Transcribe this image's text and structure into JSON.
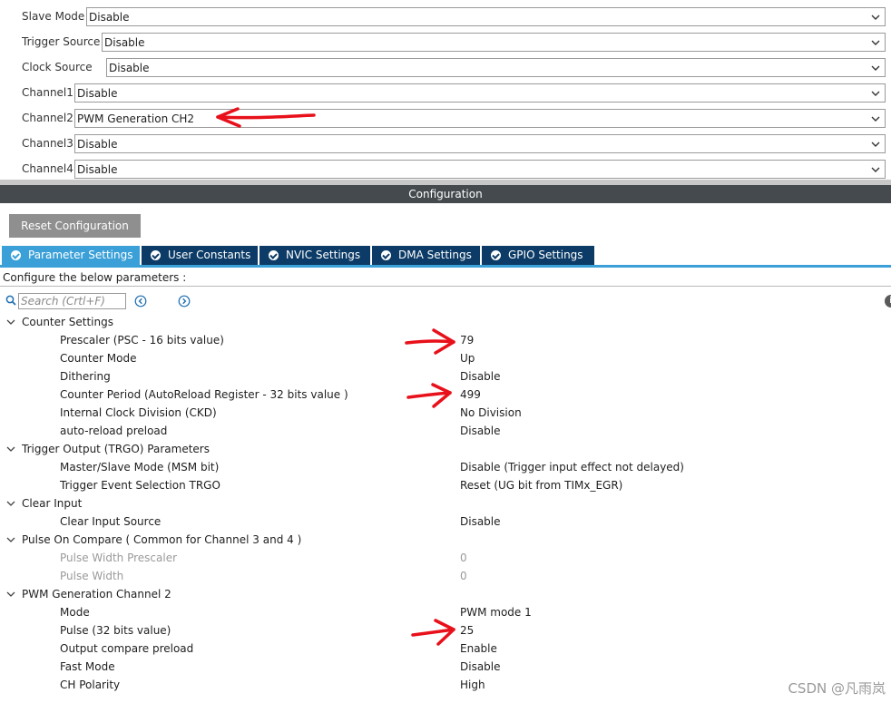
{
  "mode": {
    "rows": [
      {
        "label": "Slave Mode",
        "value": "Disable"
      },
      {
        "label": "Trigger Source",
        "value": "Disable"
      },
      {
        "label": "Clock Source",
        "value": "Disable"
      },
      {
        "label": "Channel1",
        "value": "Disable"
      },
      {
        "label": "Channel2",
        "value": "PWM Generation CH2"
      },
      {
        "label": "Channel3",
        "value": "Disable"
      },
      {
        "label": "Channel4",
        "value": "Disable"
      }
    ]
  },
  "config": {
    "title": "Configuration",
    "reset_label": "Reset Configuration",
    "tabs": [
      {
        "label": "Parameter Settings",
        "active": true
      },
      {
        "label": "User Constants",
        "active": false
      },
      {
        "label": "NVIC Settings",
        "active": false
      },
      {
        "label": "DMA Settings",
        "active": false
      },
      {
        "label": "GPIO Settings",
        "active": false
      }
    ],
    "instructions": "Configure the below parameters :",
    "search": {
      "placeholder": "Search (Crtl+F)"
    }
  },
  "groups": [
    {
      "label": "Counter Settings",
      "params": [
        {
          "label": "Prescaler (PSC - 16 bits value)",
          "value": "79"
        },
        {
          "label": "Counter Mode",
          "value": "Up"
        },
        {
          "label": "Dithering",
          "value": "Disable"
        },
        {
          "label": "Counter Period (AutoReload Register - 32 bits value )",
          "value": "499"
        },
        {
          "label": "Internal Clock Division (CKD)",
          "value": "No Division"
        },
        {
          "label": "auto-reload preload",
          "value": "Disable"
        }
      ]
    },
    {
      "label": "Trigger Output (TRGO) Parameters",
      "params": [
        {
          "label": "Master/Slave Mode (MSM bit)",
          "value": "Disable (Trigger input effect not delayed)"
        },
        {
          "label": "Trigger Event Selection TRGO",
          "value": "Reset (UG bit from TIMx_EGR)"
        }
      ]
    },
    {
      "label": "Clear Input",
      "params": [
        {
          "label": "Clear Input Source",
          "value": "Disable"
        }
      ]
    },
    {
      "label": "Pulse On Compare ( Common for Channel 3 and 4 )",
      "params": [
        {
          "label": "Pulse Width Prescaler",
          "value": "0",
          "disabled": true
        },
        {
          "label": "Pulse Width",
          "value": "0",
          "disabled": true
        }
      ]
    },
    {
      "label": "PWM Generation Channel 2",
      "params": [
        {
          "label": "Mode",
          "value": "PWM mode 1"
        },
        {
          "label": "Pulse (32 bits value)",
          "value": "25"
        },
        {
          "label": "Output compare preload",
          "value": "Enable"
        },
        {
          "label": "Fast Mode",
          "value": "Disable"
        },
        {
          "label": "CH Polarity",
          "value": "High"
        }
      ]
    }
  ],
  "watermark": "CSDN @凡雨岚",
  "colors": {
    "tab_active": "#3ba0d8",
    "tab_inactive": "#0b3b66",
    "config_bar": "#444a4e",
    "annotation": "#e8101a"
  }
}
